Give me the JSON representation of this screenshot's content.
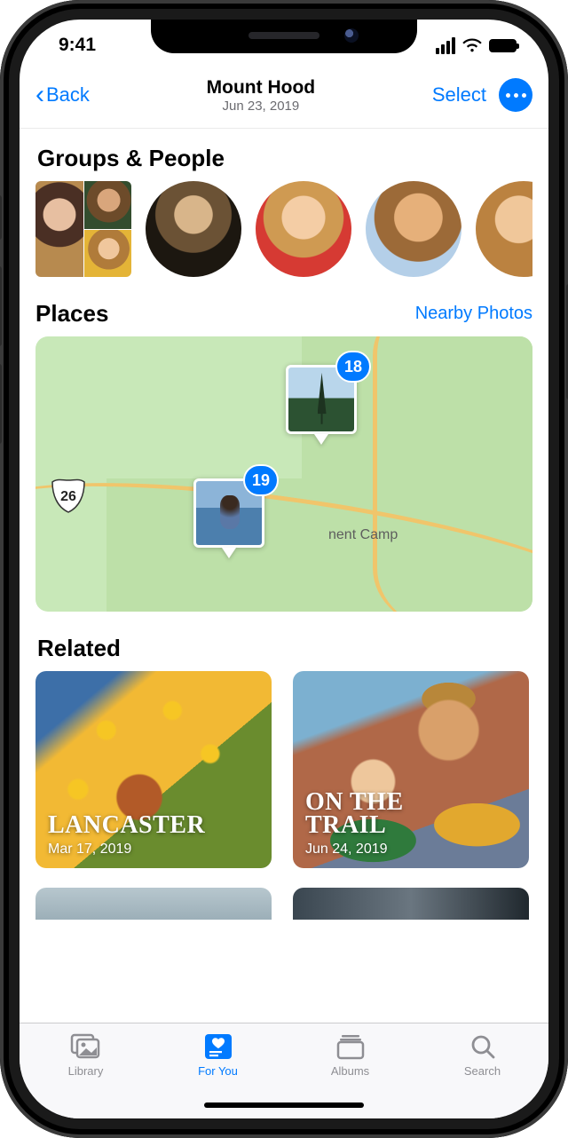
{
  "status": {
    "time": "9:41"
  },
  "nav": {
    "back": "Back",
    "title": "Mount Hood",
    "subtitle": "Jun 23, 2019",
    "select": "Select"
  },
  "sections": {
    "groups_people": "Groups & People",
    "places": "Places",
    "nearby": "Nearby Photos",
    "related": "Related"
  },
  "map": {
    "highway_label": "26",
    "place_label": "nent Camp",
    "pins": [
      {
        "count": "18"
      },
      {
        "count": "19"
      }
    ]
  },
  "related": [
    {
      "title": "LANCASTER",
      "date": "Mar 17, 2019"
    },
    {
      "title": "ON THE\nTRAIL",
      "date": "Jun 24, 2019"
    }
  ],
  "tabs": {
    "library": "Library",
    "for_you": "For You",
    "albums": "Albums",
    "search": "Search"
  }
}
